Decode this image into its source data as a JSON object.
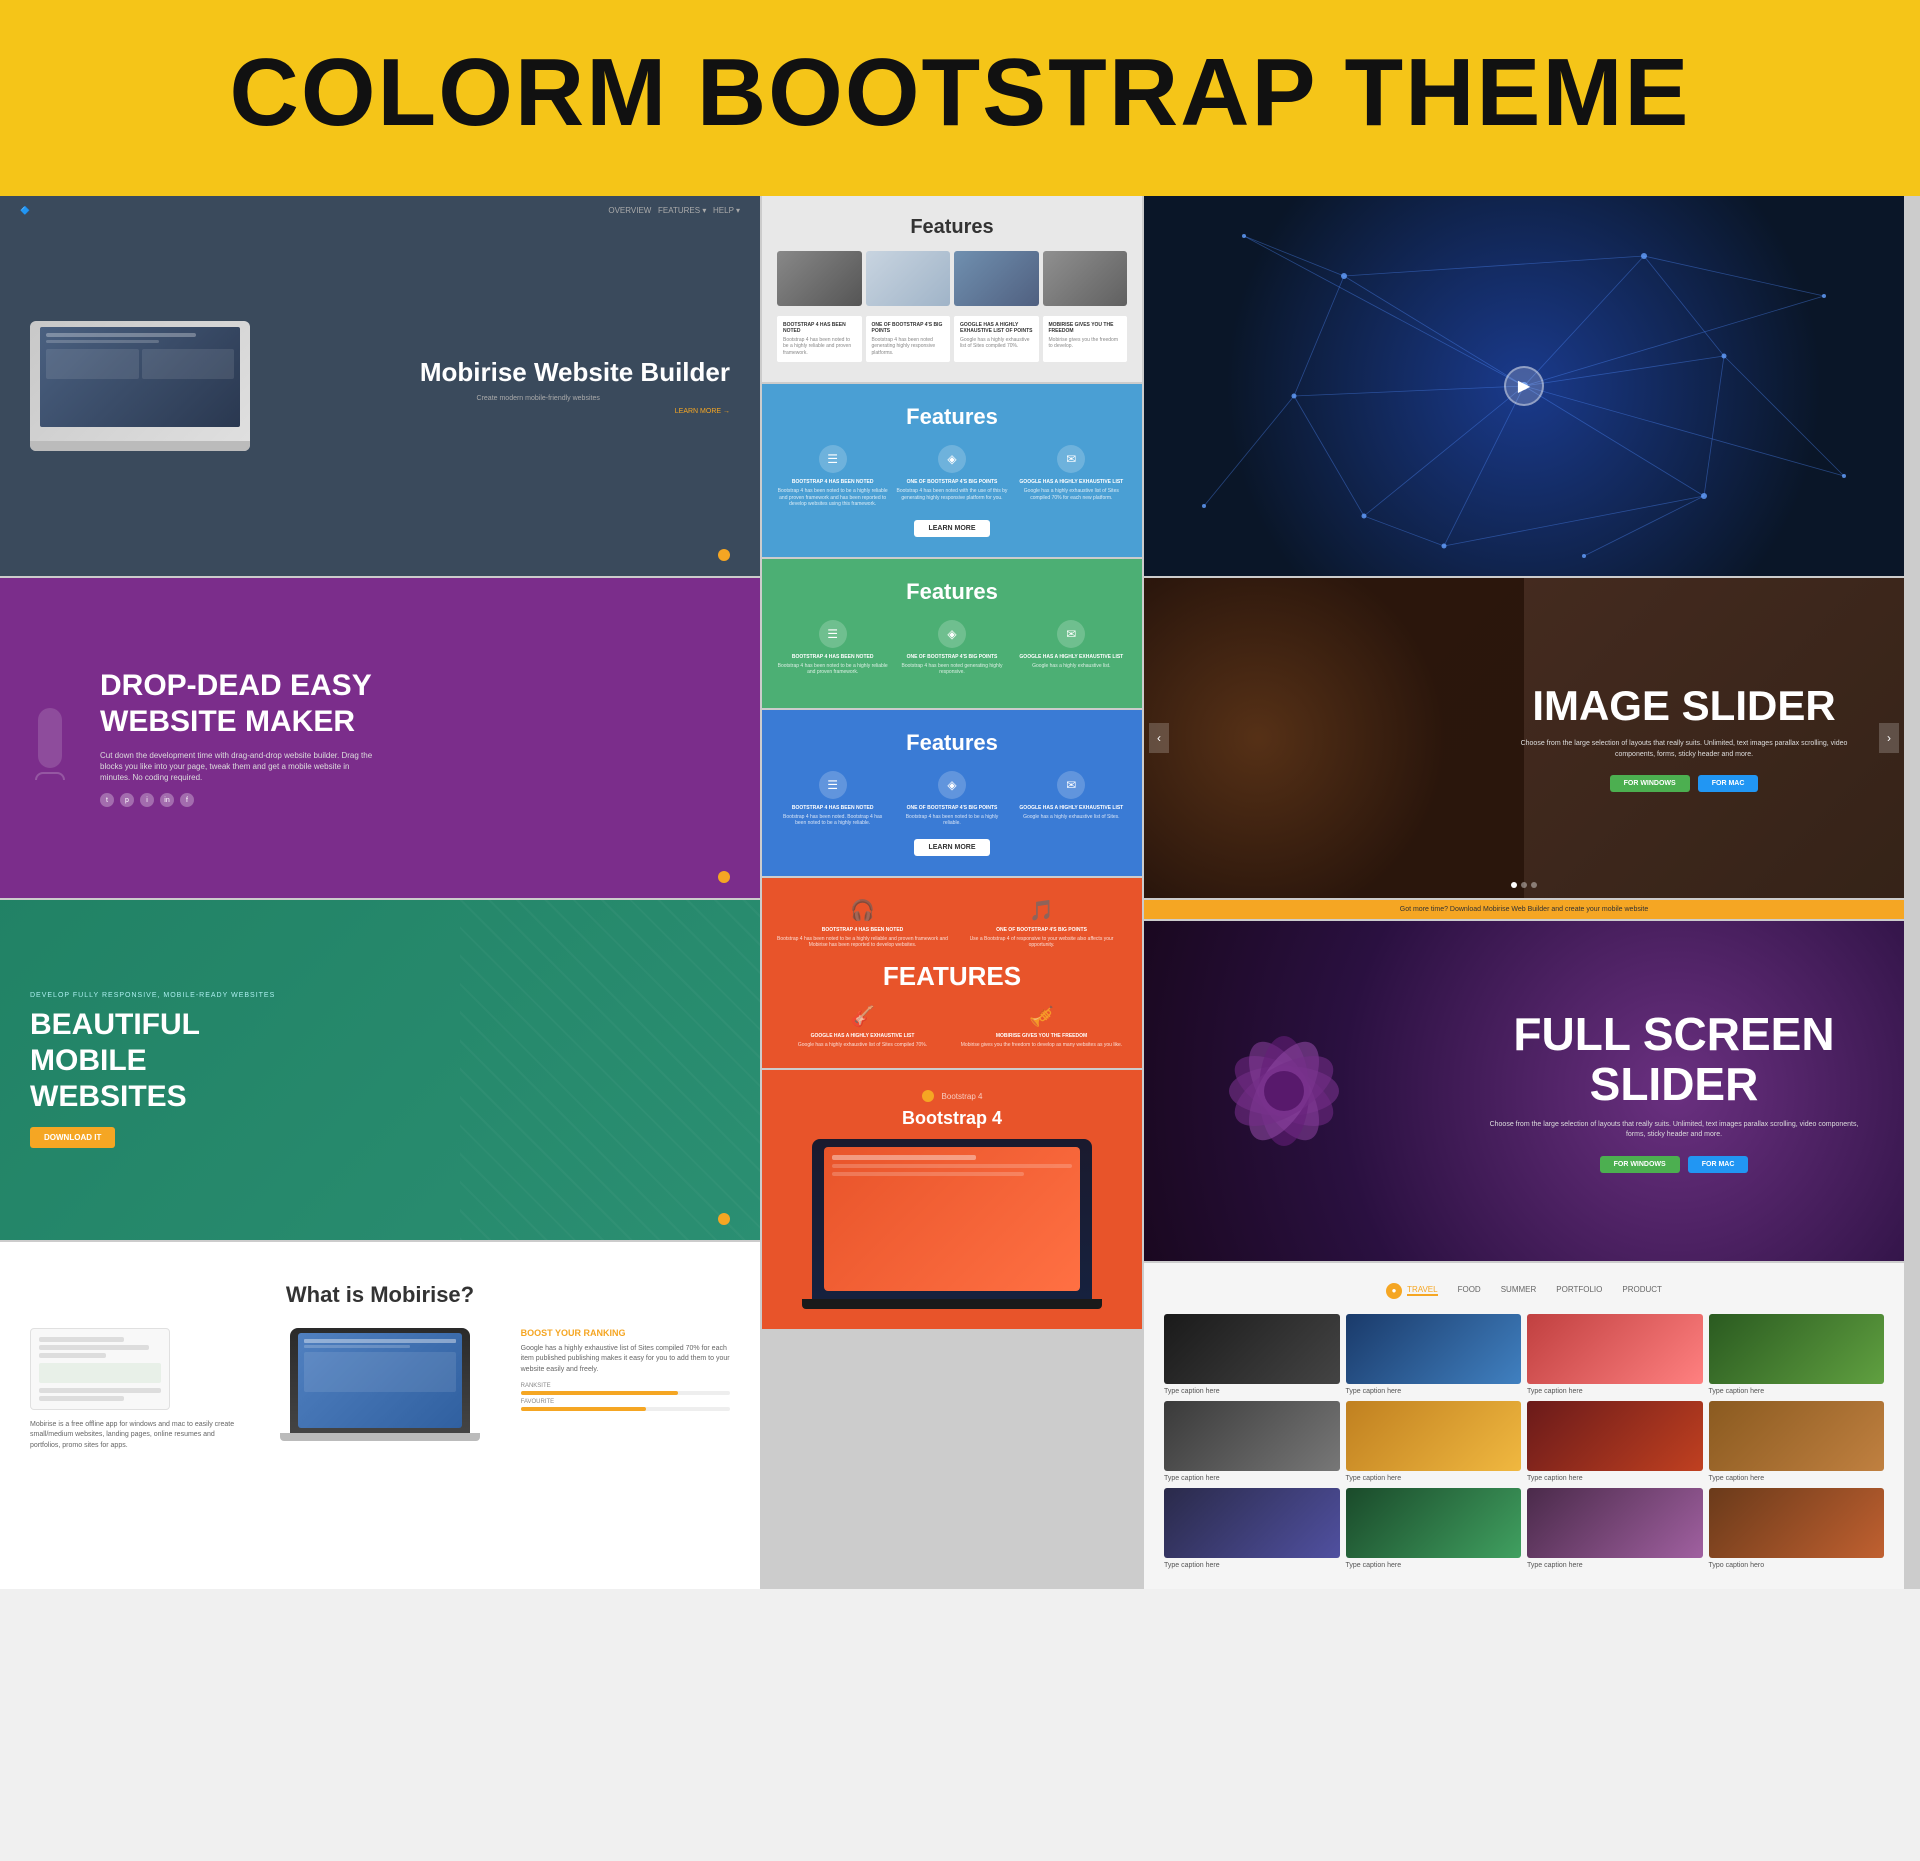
{
  "header": {
    "title": "COLORM BOOTSTRAP THEME"
  },
  "left_col": {
    "panel1": {
      "title": "Mobirise Website Builder",
      "subtitle": "Create modern mobile-friendly websites",
      "learn_more": "LEARN MORE →"
    },
    "panel2": {
      "heading": "DROP-DEAD EASY WEBSITE MAKER",
      "desc": "Cut down the development time with drag-and-drop website builder. Drag the blocks you like into your page, tweak them and get a mobile website in minutes. No coding required."
    },
    "panel3": {
      "small_text": "DEVELOP FULLY RESPONSIVE, MOBILE-READY WEBSITES",
      "heading": "BEAUTIFUL MOBILE WEBSITES",
      "download_btn": "DOWNLOAD IT"
    },
    "panel4": {
      "heading": "What is Mobirise?",
      "text1": "Mobirise is a free offline app for windows and mac to easily create small/medium websites, landing pages, online resumes and portfolios, promo sites for apps.",
      "boost_title": "BOOST YOUR RANKING",
      "boost_text": "Google has a highly exhaustive list of Sites compiled 70% for each item published publishing makes it easy for you to add them to your website easily and freely."
    }
  },
  "middle_col": {
    "fp1": {
      "heading": "Features",
      "cards": [
        {
          "title": "BOOTSTRAP 4 HAS BEEN NOTED",
          "text": "Bootstrap 4 has been noted to be a highly reliable and proven framework and Mobirise has been reported to develop websites using this framework."
        },
        {
          "title": "ONE OF BOOTSTRAP 4'S BIG POINTS",
          "text": "Bootstrap 4 has been noted to be a highly reliable and Mobirise makes effective use of this by generating highly responsive platforms for you."
        },
        {
          "title": "GOOGLE HAS A HIGHLY EXHAUSTIVE LIST OF POINTS",
          "text": "Google has a highly exhaustive list of Sites compiled 70% for each new platform publishing makes it easy for you to add them on your website easily and freely."
        },
        {
          "title": "MOBIRISE GIVES YOU THE FREEDOM TO DEVELOP",
          "text": "Mobirise gives you the freedom to develop as many websites as you like given that free it's a desktop app."
        }
      ]
    },
    "fp2": {
      "heading": "Features",
      "btn": "LEARN MORE",
      "cols": [
        {
          "title": "BOOTSTRAP 4 HAS BEEN NOTED",
          "text": "Bootstrap 4 has been noted to be a highly reliable and proven framework and has been reported to develop websites using this framework."
        },
        {
          "title": "ONE OF BOOTSTRAP 4'S BIG POINTS",
          "text": "Bootstrap 4 has been noted with the use of this by generating highly responsive platform for you."
        },
        {
          "title": "GOOGLE HAS A HIGHLY EXHAUSTIVE LIST OF POINTS",
          "text": "Google has a highly exhaustive list of Sites compiled 70% for each new platform and Mobirise makes it easy."
        }
      ]
    },
    "fp3": {
      "heading": "Features",
      "cols": [
        {
          "title": "BOOTSTRAP 4 HAS BEEN NOTED",
          "text": "Bootstrap 4 has been noted to be a highly reliable and proven framework and Mobirise has been reported to develop websites using this framework."
        },
        {
          "title": "ONE OF BOOTSTRAP 4'S BIG POINTS",
          "text": "Bootstrap 4 has been noted with the use of this by generating highly responsive."
        },
        {
          "title": "GOOGLE HAS A HIGHLY EXHAUSTIVE LIST OF POINTS",
          "text": "Google has a highly exhaustive list of Sites compiled 70%."
        }
      ]
    },
    "fp4": {
      "heading": "Features",
      "btn": "LEARN MORE",
      "cols": [
        {
          "title": "BOOTSTRAP 4 HAS BEEN NOTED",
          "text": "Bootstrap 4 has been noted. Bootstrap 4 has been noted to be a highly reliable."
        },
        {
          "title": "ONE OF BOOTSTRAP 4'S BIG POINTS",
          "text": "Bootstrap 4 has been noted to be a highly reliable."
        },
        {
          "title": "GOOGLE HAS A HIGHLY EXHAUSTIVE LIST OF POINTS",
          "text": "Google has a highly exhaustive list of Sites."
        }
      ]
    },
    "fp5": {
      "heading": "FEATURES",
      "cols": [
        {
          "title": "BOOTSTRAP 4 HAS BEEN NOTED",
          "text": "Bootstrap 4 has been noted to be a highly reliable and proven framework and Mobirise has been reported to develop websites."
        },
        {
          "title": "ONE OF BOOTSTRAP 4'S BIG POINTS",
          "text": "Use a Bootstrap 4 of responsive to your website also affects your opportunity."
        },
        {
          "title": "GOOGLE HAS A HIGHLY EXHAUSTIVE LIST OF POINTS",
          "text": "Google has a highly exhaustive list of Sites compiled 70%."
        },
        {
          "title": "MOBIRISE GIVES YOU THE FREEDOM TO DEVELOP",
          "text": "Mobirise gives you the freedom to develop as many websites as you like."
        }
      ]
    },
    "fp_bottom": {
      "label": "Bootstrap 4",
      "title": "Bootstrap 4"
    }
  },
  "right_col": {
    "panel_network": {
      "has_play": true
    },
    "panel_slider": {
      "heading": "IMAGE SLIDER",
      "desc": "Choose from the large selection of layouts that really suits. Unlimited, text images parallax scrolling, video components, forms, sticky header and more.",
      "btn_win": "FOR WINDOWS",
      "btn_mac": "FOR MAC"
    },
    "orange_bar": {
      "text": "Got more time? Download Mobirise Web Builder and create your mobile website"
    },
    "panel_fullscreen": {
      "heading": "FULL SCREEN SLIDER",
      "desc": "Choose from the large selection of layouts that really suits. Unlimited, text images parallax scrolling, video components, forms, sticky header and more.",
      "btn_win": "FOR WINDOWS",
      "btn_mac": "FOR MAC"
    },
    "gallery": {
      "nav_items": [
        "TRAVEL",
        "FOOD",
        "SUMMER",
        "PORTFOLIO",
        "PRODUCT"
      ],
      "active_nav": 0,
      "items": [
        {
          "caption": "Type caption here",
          "img_class": "g-img-1"
        },
        {
          "caption": "Type caption here",
          "img_class": "g-img-2"
        },
        {
          "caption": "Type caption here",
          "img_class": "g-img-3"
        },
        {
          "caption": "Type caption here",
          "img_class": "g-img-4"
        },
        {
          "caption": "Type caption here",
          "img_class": "g-img-5"
        },
        {
          "caption": "Type caption here",
          "img_class": "g-img-6"
        },
        {
          "caption": "Type caption here",
          "img_class": "g-img-7"
        },
        {
          "caption": "Type caption here",
          "img_class": "g-img-8"
        },
        {
          "caption": "Type caption here",
          "img_class": "g-img-9"
        },
        {
          "caption": "Type caption here",
          "img_class": "g-img-10"
        },
        {
          "caption": "Type caption here",
          "img_class": "g-img-11"
        },
        {
          "caption": "Typo caption hero",
          "img_class": "g-img-12"
        }
      ]
    }
  }
}
